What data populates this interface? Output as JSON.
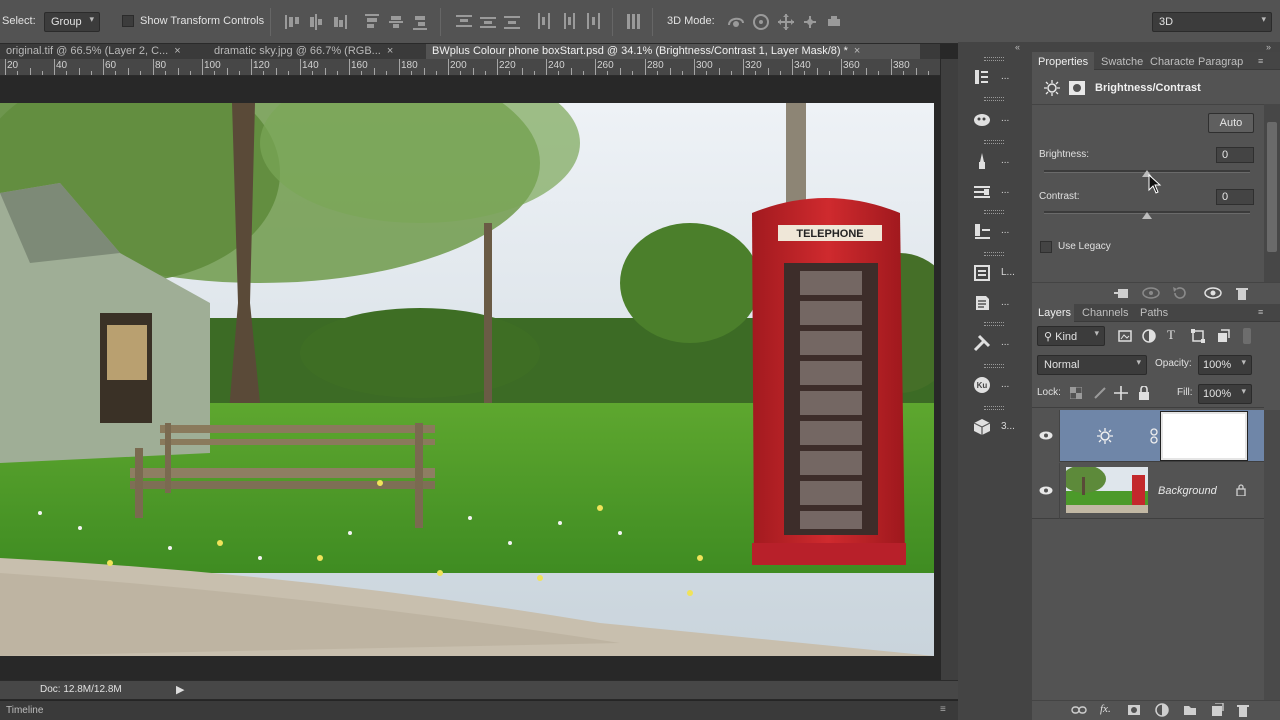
{
  "options_bar": {
    "select_label": "Select:",
    "auto_select_value": "Group",
    "transform_controls_label": "Show Transform Controls",
    "mode3d_label": "3D Mode:",
    "workspace_value": "3D"
  },
  "document_tabs": [
    {
      "label": "original.tif @ 66.5% (Layer 2, C...",
      "active": false
    },
    {
      "label": "dramatic sky.jpg @ 66.7% (RGB...",
      "active": false
    },
    {
      "label": "BWplus Colour phone boxStart.psd @ 34.1% (Brightness/Contrast 1, Layer Mask/8) *",
      "active": true
    }
  ],
  "ruler_labels": [
    "20",
    "40",
    "60",
    "80",
    "100",
    "120",
    "140",
    "160",
    "180",
    "200",
    "220",
    "240",
    "260",
    "280",
    "300",
    "320",
    "340",
    "360",
    "380"
  ],
  "status": {
    "doc_info": "Doc: 12.8M/12.8M",
    "timeline_label": "Timeline"
  },
  "dock": [
    {
      "icon": "history-icon",
      "label": "..."
    },
    {
      "icon": "actions-icon",
      "label": "..."
    },
    {
      "icon": "brush-presets-icon",
      "label": "..."
    },
    {
      "icon": "clone-source-icon",
      "label": "..."
    },
    {
      "icon": "layer-comps-icon",
      "label": "..."
    },
    {
      "icon": "info-icon",
      "label": "L..."
    },
    {
      "icon": "notes-icon",
      "label": "..."
    },
    {
      "icon": "tool-presets-icon",
      "label": "..."
    },
    {
      "icon": "kuler-icon",
      "label": "..."
    },
    {
      "icon": "3d-icon",
      "label": "3..."
    }
  ],
  "properties_panel": {
    "tabs": [
      "Properties",
      "Swatche",
      "Characte",
      "Paragrap"
    ],
    "adjustment_title": "Brightness/Contrast",
    "auto_label": "Auto",
    "brightness_label": "Brightness:",
    "brightness_value": "0",
    "contrast_label": "Contrast:",
    "contrast_value": "0",
    "legacy_label": "Use Legacy"
  },
  "layers_panel": {
    "tabs": [
      "Layers",
      "Channels",
      "Paths"
    ],
    "filter_kind": "Kind",
    "blend_mode": "Normal",
    "opacity_label": "Opacity:",
    "opacity_value": "100%",
    "lock_label": "Lock:",
    "fill_label": "Fill:",
    "fill_value": "100%",
    "layers": [
      {
        "name": "",
        "type": "adjustment",
        "selected": true
      },
      {
        "name": "Background",
        "type": "image",
        "selected": false
      }
    ]
  },
  "colors": {
    "ui_dark": "#282828",
    "panel_bg": "#535353",
    "selected_layer": "#6f86a8",
    "phone_box_red": "#c8252b",
    "grass": "#5fae34"
  }
}
